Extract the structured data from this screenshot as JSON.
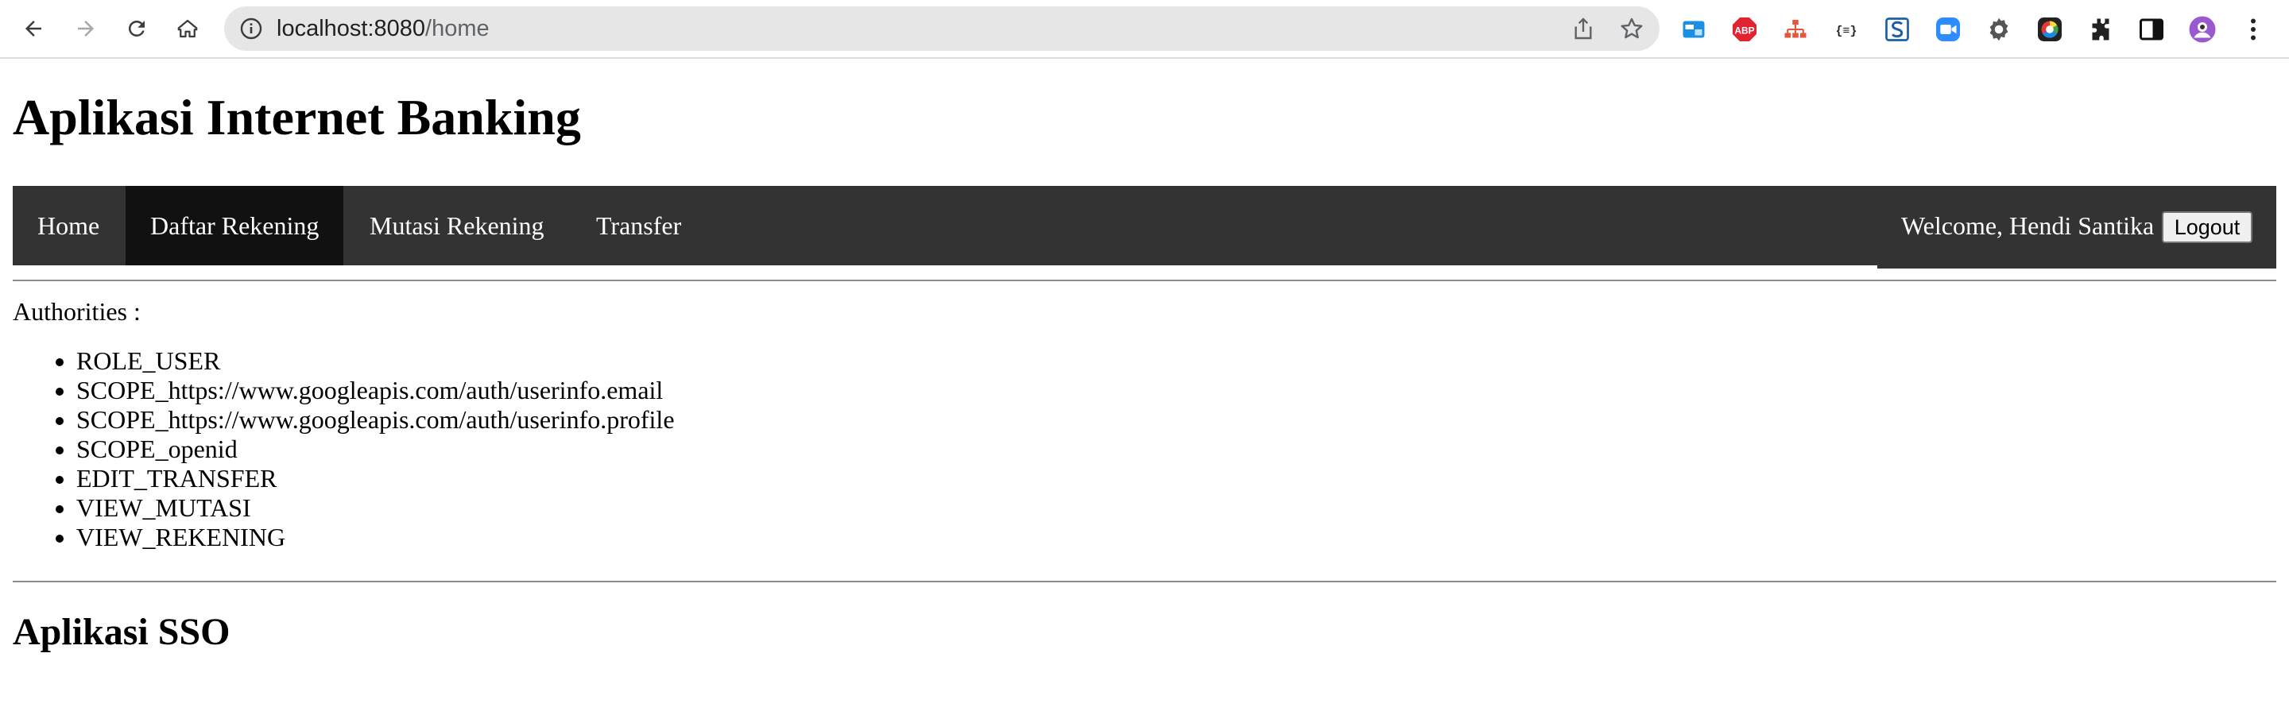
{
  "browser": {
    "url_host": "localhost:8080",
    "url_path": "/home",
    "icons": {
      "back": "arrow-left-icon",
      "forward": "arrow-right-icon",
      "reload": "reload-icon",
      "home": "home-icon",
      "site_info": "info-icon",
      "share": "share-icon",
      "bookmark": "star-icon"
    },
    "extensions": [
      "window-extension-icon",
      "adblock-plus-icon",
      "sitemap-extension-icon",
      "json-formatter-icon",
      "s-extension-icon",
      "zoom-extension-icon",
      "gear-extension-icon",
      "color-picker-extension-icon",
      "puzzle-extensions-icon",
      "side-panel-icon",
      "profile-avatar",
      "more-menu-icon"
    ],
    "extension_labels": {
      "abp": "ABP",
      "json": "{≡}"
    }
  },
  "app": {
    "title": "Aplikasi Internet Banking",
    "nav": [
      "Home",
      "Daftar Rekening",
      "Mutasi Rekening",
      "Transfer"
    ],
    "active_nav": "Daftar Rekening",
    "welcome": "Welcome, Hendi Santika",
    "logout_label": "Logout",
    "authorities_label": "Authorities :",
    "authorities": [
      "ROLE_USER",
      "SCOPE_https://www.googleapis.com/auth/userinfo.email",
      "SCOPE_https://www.googleapis.com/auth/userinfo.profile",
      "SCOPE_openid",
      "EDIT_TRANSFER",
      "VIEW_MUTASI",
      "VIEW_REKENING"
    ],
    "sso_title": "Aplikasi SSO"
  },
  "colors": {
    "navbar": "#333333",
    "navbar_active": "#111111",
    "navbar_text": "#ffffff",
    "omnibox": "#e6e6e6"
  }
}
